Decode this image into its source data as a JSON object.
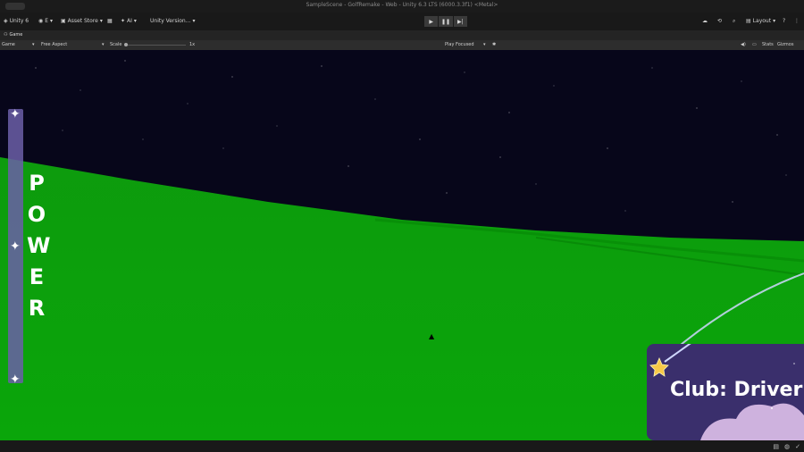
{
  "window": {
    "title": "SampleScene - GolfRemake - Web - Unity 6.3 LTS (6000.3.3f1) <Metal>"
  },
  "toolbar": {
    "unity_label": "Unity 6",
    "account_label": "E",
    "asset_store_label": "Asset Store",
    "ai_label": "AI",
    "version_label": "Unity Version...",
    "layout_label": "Layout"
  },
  "tab": {
    "label": "Game"
  },
  "gamebar": {
    "display": "Game",
    "aspect": "Free Aspect",
    "scale_label": "Scale",
    "scale_value": "1x",
    "play_mode": "Play Focused",
    "stats": "Stats",
    "gizmos": "Gizmos"
  },
  "hud": {
    "power_letters": [
      "P",
      "O",
      "W",
      "E",
      "R"
    ],
    "club_text": "Club: Driver I"
  },
  "colors": {
    "grass": "#0aa60a",
    "sky": "#07061a",
    "power_bar": "#6b5fa8",
    "club_card": "#3a2f6c"
  },
  "icons": [
    "unity-logo-icon",
    "account-icon",
    "store-icon",
    "ai-icon",
    "play-icon",
    "pause-icon",
    "step-icon",
    "cloud-icon",
    "history-icon",
    "search-icon",
    "help-icon",
    "sparkle-icon",
    "star-icon",
    "cloud-shape-icon",
    "mute-icon",
    "stats-icon"
  ]
}
